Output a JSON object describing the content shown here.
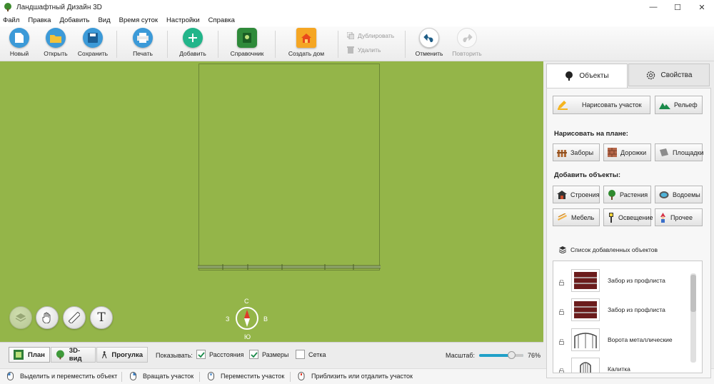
{
  "window": {
    "title": "Ландшафтный Дизайн 3D",
    "minimize": "—",
    "maximize": "☐",
    "close": "✕"
  },
  "menu": [
    "Файл",
    "Правка",
    "Добавить",
    "Вид",
    "Время суток",
    "Настройки",
    "Справка"
  ],
  "toolbar": {
    "new": "Новый",
    "open": "Открыть",
    "save": "Сохранить",
    "print": "Печать",
    "add": "Добавить",
    "reference": "Справочник",
    "create_house": "Создать дом",
    "duplicate": "Дублировать",
    "delete": "Удалить",
    "undo": "Отменить",
    "redo": "Повторить"
  },
  "canvas": {
    "grass_color": "#94b549",
    "compass": {
      "north": "С",
      "south": "Ю",
      "west": "З",
      "east": "В"
    },
    "text_tool": "T"
  },
  "bottom": {
    "tabs": [
      "План",
      "3D-вид",
      "Прогулка"
    ],
    "show_label": "Показывать:",
    "checks": [
      {
        "label": "Расстояния",
        "checked": true
      },
      {
        "label": "Размеры",
        "checked": true
      },
      {
        "label": "Сетка",
        "checked": false
      }
    ],
    "zoom_label": "Масштаб:",
    "zoom_value": "76%",
    "zoom_fraction": 0.76
  },
  "status": [
    "Выделить и переместить объект",
    "Вращать участок",
    "Переместить участок",
    "Приблизить или отдалить участок"
  ],
  "panel": {
    "tab_objects": "Объекты",
    "tab_properties": "Свойства",
    "draw_plot": "Нарисовать участок",
    "relief": "Рельеф",
    "draw_on_plan": "Нарисовать на плане:",
    "draw_items": [
      "Заборы",
      "Дорожки",
      "Площадки"
    ],
    "add_objects": "Добавить объекты:",
    "add_items": [
      "Строения",
      "Растения",
      "Водоемы",
      "Мебель",
      "Освещение",
      "Прочее"
    ],
    "list_title": "Список добавленных объектов",
    "list": [
      "Забор из профлиста",
      "Забор из профлиста",
      "Ворота металлические",
      "Калитка"
    ]
  }
}
